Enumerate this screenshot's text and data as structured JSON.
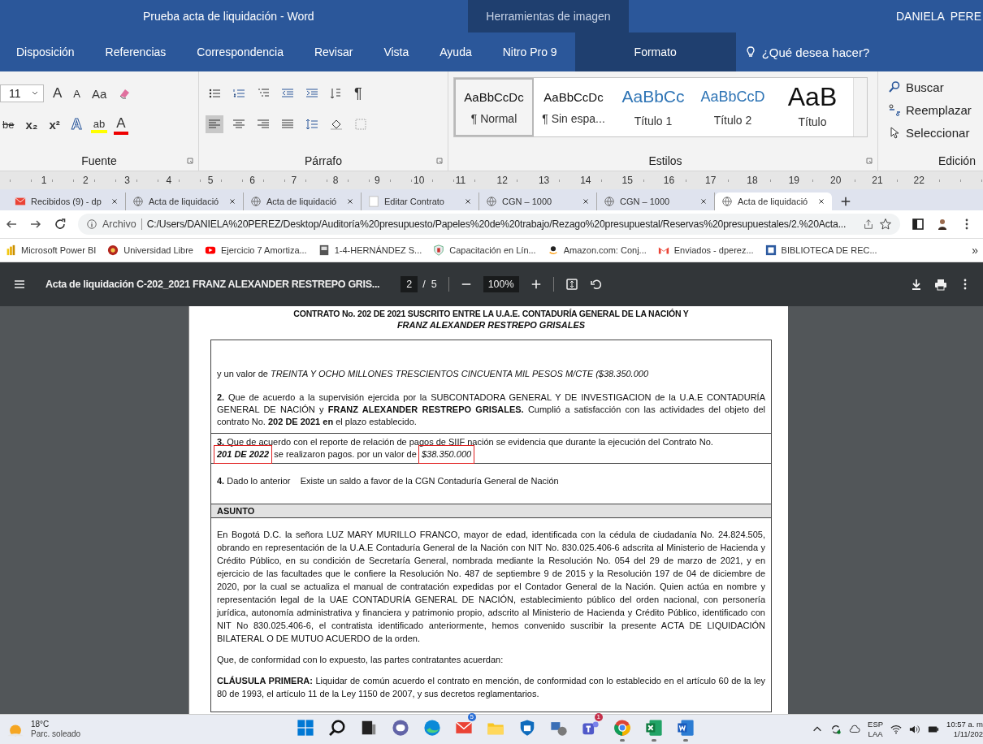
{
  "word": {
    "title": "Prueba acta de liquidación  -  Word",
    "context_group": "Herramientas de imagen",
    "user": "DANIELA  PERE",
    "tabs": [
      {
        "label": "Disposición",
        "kind": "normal"
      },
      {
        "label": "Referencias",
        "kind": "normal"
      },
      {
        "label": "Correspondencia",
        "kind": "normal"
      },
      {
        "label": "Revisar",
        "kind": "normal"
      },
      {
        "label": "Vista",
        "kind": "normal"
      },
      {
        "label": "Ayuda",
        "kind": "normal"
      },
      {
        "label": "Nitro Pro 9",
        "kind": "normal"
      },
      {
        "label": "Formato",
        "kind": "contextual"
      }
    ],
    "tell_me": "¿Qué desea hacer?"
  },
  "ribbon": {
    "font": {
      "label": "Fuente",
      "size": "11",
      "row1": [
        {
          "kind": "grow",
          "text": "A"
        },
        {
          "kind": "shrink",
          "text": "A"
        },
        {
          "kind": "case",
          "text": "Aa"
        },
        {
          "kind": "clear"
        }
      ],
      "row2": [
        {
          "kind": "strike",
          "text": "be"
        },
        {
          "kind": "sub",
          "text": "x₂"
        },
        {
          "kind": "sup",
          "text": "x²"
        },
        {
          "kind": "effects",
          "text": "A"
        },
        {
          "kind": "highlight",
          "text": "ab"
        },
        {
          "kind": "fontcolor",
          "text": "A"
        }
      ]
    },
    "paragraph": {
      "label": "Párrafo",
      "pilcrow": "¶",
      "align": [
        {
          "kind": "left",
          "selected": true
        },
        {
          "kind": "center",
          "selected": false
        },
        {
          "kind": "right",
          "selected": false
        },
        {
          "kind": "justify",
          "selected": false
        }
      ]
    },
    "styles": {
      "label": "Estilos",
      "items": [
        {
          "preview": "AaBbCcDc",
          "name": "¶ Normal",
          "kind": "normal",
          "selected": true
        },
        {
          "preview": "AaBbCcDc",
          "name": "¶ Sin espa...",
          "kind": "normal",
          "selected": false
        },
        {
          "preview": "AaBbCc",
          "name": "Título 1",
          "kind": "heading1",
          "selected": false
        },
        {
          "preview": "AaBbCcD",
          "name": "Título 2",
          "kind": "heading2",
          "selected": false
        },
        {
          "preview": "AaB",
          "name": "Título",
          "kind": "title",
          "selected": false
        }
      ]
    },
    "editing": {
      "label": "Edición",
      "items": [
        {
          "kind": "find",
          "label": "Buscar"
        },
        {
          "kind": "replace",
          "label": "Reemplazar"
        },
        {
          "kind": "select",
          "label": "Seleccionar"
        }
      ]
    }
  },
  "ruler": [
    "1",
    "2",
    "3",
    "4",
    "5",
    "6",
    "7",
    "8",
    "9",
    "10",
    "11",
    "12",
    "13",
    "14",
    "15",
    "16",
    "17",
    "18",
    "19",
    "20",
    "21",
    "22"
  ],
  "browser": {
    "tabs": [
      {
        "title": "Recibidos (9) - dp",
        "kind": "mail",
        "selected": false
      },
      {
        "title": "Acta de liquidació",
        "kind": "globe",
        "selected": false
      },
      {
        "title": "Acta de liquidació",
        "kind": "globe",
        "selected": false
      },
      {
        "title": "Editar Contrato",
        "kind": "blank",
        "selected": false
      },
      {
        "title": "CGN – 1000",
        "kind": "globe",
        "selected": false
      },
      {
        "title": "CGN – 1000",
        "kind": "globe",
        "selected": false
      },
      {
        "title": "Acta de liquidació",
        "kind": "globe",
        "selected": true
      }
    ],
    "scheme": "Archivo",
    "url": "C:/Users/DANIELA%20PEREZ/Desktop/Auditoría%20presupuesto/Papeles%20de%20trabajo/Rezago%20presupuestal/Reservas%20presupuestales/2.%20Acta...",
    "bookmarks": [
      {
        "title": "Microsoft Power BI",
        "kind": "powerbi"
      },
      {
        "title": "Universidad Libre",
        "kind": "ulibre"
      },
      {
        "title": "Ejercicio 7 Amortiza...",
        "kind": "youtube"
      },
      {
        "title": "1-4-HERNÁNDEZ S...",
        "kind": "doc"
      },
      {
        "title": "Capacitación en Lín...",
        "kind": "shield"
      },
      {
        "title": "Amazon.com: Conj...",
        "kind": "amazon"
      },
      {
        "title": "Enviados - dperez...",
        "kind": "gmail"
      },
      {
        "title": "BIBLIOTECA DE REC...",
        "kind": "library"
      }
    ],
    "more": "»"
  },
  "pdf": {
    "title": "Acta de liquidación C-202_2021 FRANZ ALEXANDER RESTREPO GRIS...",
    "page": "2",
    "total": "/  5",
    "zoom": "100%"
  },
  "document": {
    "heading": [
      "CONTRATO No. 202 DE 2021 SUSCRITO ENTRE LA U.A.E. CONTADURÍA GENERAL DE LA NACIÓN Y",
      "FRANZ ALEXANDER RESTREPO GRISALES"
    ],
    "rows": [
      {
        "paragraphs": [
          "y un valor de *TREINTA Y OCHO MILLONES TRESCIENTOS CINCUENTA MIL PESOS M/CTE ($38.350.000*",
          "**2.** Que de acuerdo a la supervisión ejercida por la SUBCONTADORA GENERAL Y DE INVESTIGACION de la U.A.E CONTADURÍA GENERAL DE NACIÓN y **FRANZ ALEXANDER RESTREPO GRISALES.** Cumplió a satisfacción con las actividades del objeto del contrato No. **202 DE 2021 en** el plazo establecido."
        ]
      },
      {
        "segments": [
          {
            "text": "**3.** Que de acuerdo con el reporte de relación de pagos de SIIF nación se evidencia que durante la ejecución del Contrato No.",
            "boxed": false,
            "kind": "plain"
          },
          {
            "text": "201 DE 2022",
            "boxed": true,
            "kind": "contract-number"
          },
          {
            "text": "se realizaron pagos. por un valor de",
            "boxed": false,
            "kind": "plain"
          },
          {
            "text": "$38.350.000",
            "boxed": true,
            "kind": "amount"
          }
        ]
      },
      {
        "paragraphs": [
          "**4.** Dado lo anterior    Existe un saldo a favor de la CGN Contaduría General de Nación"
        ]
      }
    ],
    "section": "ASUNTO",
    "body": [
      "En Bogotá D.C. la señora LUZ MARY MURILLO FRANCO, mayor de edad, identificada con la cédula de ciudadanía No. 24.824.505, obrando en representación de la U.A.E Contaduría General de la Nación con NIT No. 830.025.406-6 adscrita al Ministerio de Hacienda y Crédito Público, en su condición de Secretaría General, nombrada mediante la Resolución No. 054 del 29 de marzo de 2021, y en ejercicio de las facultades que le confiere la Resolución No. 487 de septiembre 9 de 2015 y la Resolución 197 de 04 de diciembre de 2020, por la cual se actualiza el manual de contratación expedidas por el Contador General de la Nación. Quien actúa en nombre y representación legal de la UAE CONTADURÍA GENERAL DE NACIÓN, establecimiento público del orden nacional, con personería jurídica, autonomía administrativa y financiera y patrimonio propio, adscrito al Ministerio de Hacienda y Crédito Público, identificado con NIT No 830.025.406-6, el contratista identificado anteriormente, hemos convenido suscribir la presente ACTA DE LIQUIDACIÓN BILATERAL O DE MUTUO ACUERDO de la orden.",
      "Que, de conformidad con lo expuesto, las partes contratantes acuerdan:",
      "**CLÁUSULA PRIMERA:** Liquidar de común acuerdo el contrato en mención, de conformidad con lo establecido en el artículo 60 de la ley 80 de 1993, el artículo 11 de la Ley 1150 de 2007, y sus decretos reglamentarios."
    ]
  },
  "taskbar": {
    "temperature": "18°C",
    "weather": "Parc. soleado",
    "apps": [
      {
        "kind": "start",
        "running": false
      },
      {
        "kind": "search",
        "running": false
      },
      {
        "kind": "taskview",
        "running": false
      },
      {
        "kind": "chat",
        "running": false
      },
      {
        "kind": "edge",
        "running": false
      },
      {
        "kind": "mail",
        "running": false,
        "badge": "5"
      },
      {
        "kind": "folder",
        "running": false
      },
      {
        "kind": "defender",
        "running": false
      },
      {
        "kind": "app",
        "running": false
      },
      {
        "kind": "teams",
        "running": false,
        "badge": "1"
      },
      {
        "kind": "chrome",
        "running": true
      },
      {
        "kind": "excel",
        "running": true
      },
      {
        "kind": "word",
        "running": true
      }
    ],
    "lang": "ESP",
    "layout": "LAA",
    "time": "10:57 a. m",
    "date": "1/11/202"
  }
}
